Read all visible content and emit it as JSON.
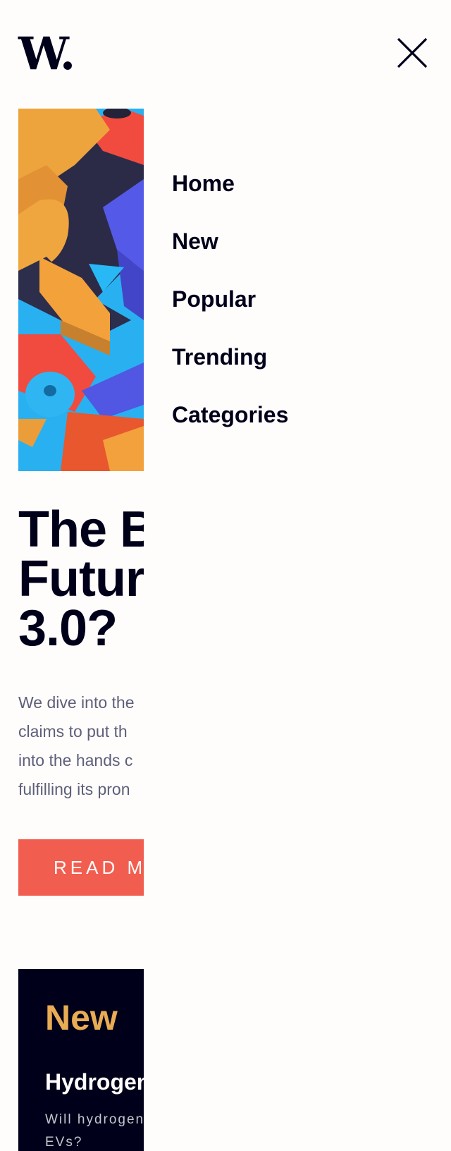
{
  "header": {
    "logo_text": "W.",
    "close_icon": "close-icon"
  },
  "hero": {
    "image_icon": "abstract-3d-blocks-image",
    "headline": "The B\nFutur\n3.0?",
    "excerpt": "We dive into the\nclaims to put th\ninto the hands c\nfulfilling its pron",
    "read_more_label": "READ M"
  },
  "new_section": {
    "heading": "New",
    "items": [
      {
        "title": "Hydrogen",
        "description": "Will hydrogen\nEVs?"
      }
    ]
  },
  "menu": {
    "items": [
      {
        "label": "Home"
      },
      {
        "label": "New"
      },
      {
        "label": "Popular"
      },
      {
        "label": "Trending"
      },
      {
        "label": "Categories"
      }
    ]
  },
  "colors": {
    "background": "#fffdfc",
    "dark": "#00001a",
    "accent_red": "#f15e50",
    "accent_orange": "#e9ab53",
    "text_muted": "#5d5f79"
  }
}
